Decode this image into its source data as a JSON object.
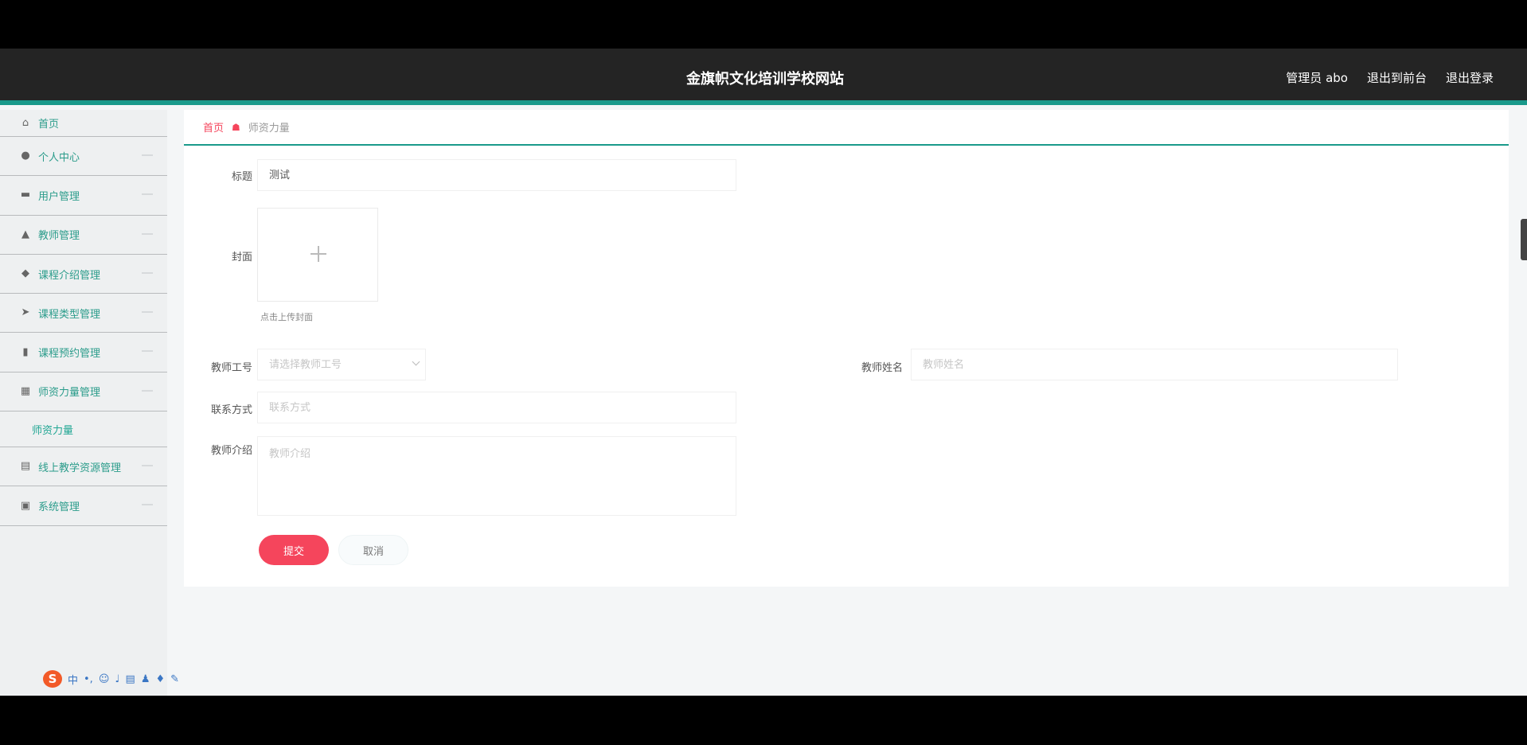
{
  "header": {
    "title": "金旗帜文化培训学校网站",
    "links": [
      "管理员 abo",
      "退出到前台",
      "退出登录"
    ]
  },
  "sidebar": {
    "items": [
      {
        "label": "首页",
        "icon": "home-icon"
      },
      {
        "label": "个人中心",
        "icon": "user-icon"
      },
      {
        "label": "用户管理",
        "icon": "monitor-icon"
      },
      {
        "label": "教师管理",
        "icon": "teacher-icon"
      },
      {
        "label": "课程介绍管理",
        "icon": "location-icon"
      },
      {
        "label": "课程类型管理",
        "icon": "paper-plane-icon"
      },
      {
        "label": "课程预约管理",
        "icon": "bar-chart-icon"
      },
      {
        "label": "师资力量管理",
        "icon": "building-icon"
      },
      {
        "label": "线上教学资源管理",
        "icon": "calendar-icon"
      },
      {
        "label": "系统管理",
        "icon": "window-icon"
      }
    ],
    "submenu": "师资力量"
  },
  "breadcrumb": {
    "home": "首页",
    "current": "师资力量"
  },
  "form": {
    "title_label": "标题",
    "title_value": "测试",
    "cover_label": "封面",
    "upload_hint": "点击上传封面",
    "teacher_no_label": "教师工号",
    "teacher_no_placeholder": "请选择教师工号",
    "teacher_name_label": "教师姓名",
    "teacher_name_placeholder": "教师姓名",
    "contact_label": "联系方式",
    "contact_placeholder": "联系方式",
    "intro_label": "教师介绍",
    "intro_placeholder": "教师介绍",
    "submit_label": "提交",
    "cancel_label": "取消"
  },
  "taskbar": {
    "ime_logo": "S",
    "ime_mode": "中"
  },
  "colors": {
    "header_bg": "#242424",
    "accent": "#1a9a8b",
    "submit": "#f5455c",
    "sidebar_text": "#2b9c8b"
  }
}
